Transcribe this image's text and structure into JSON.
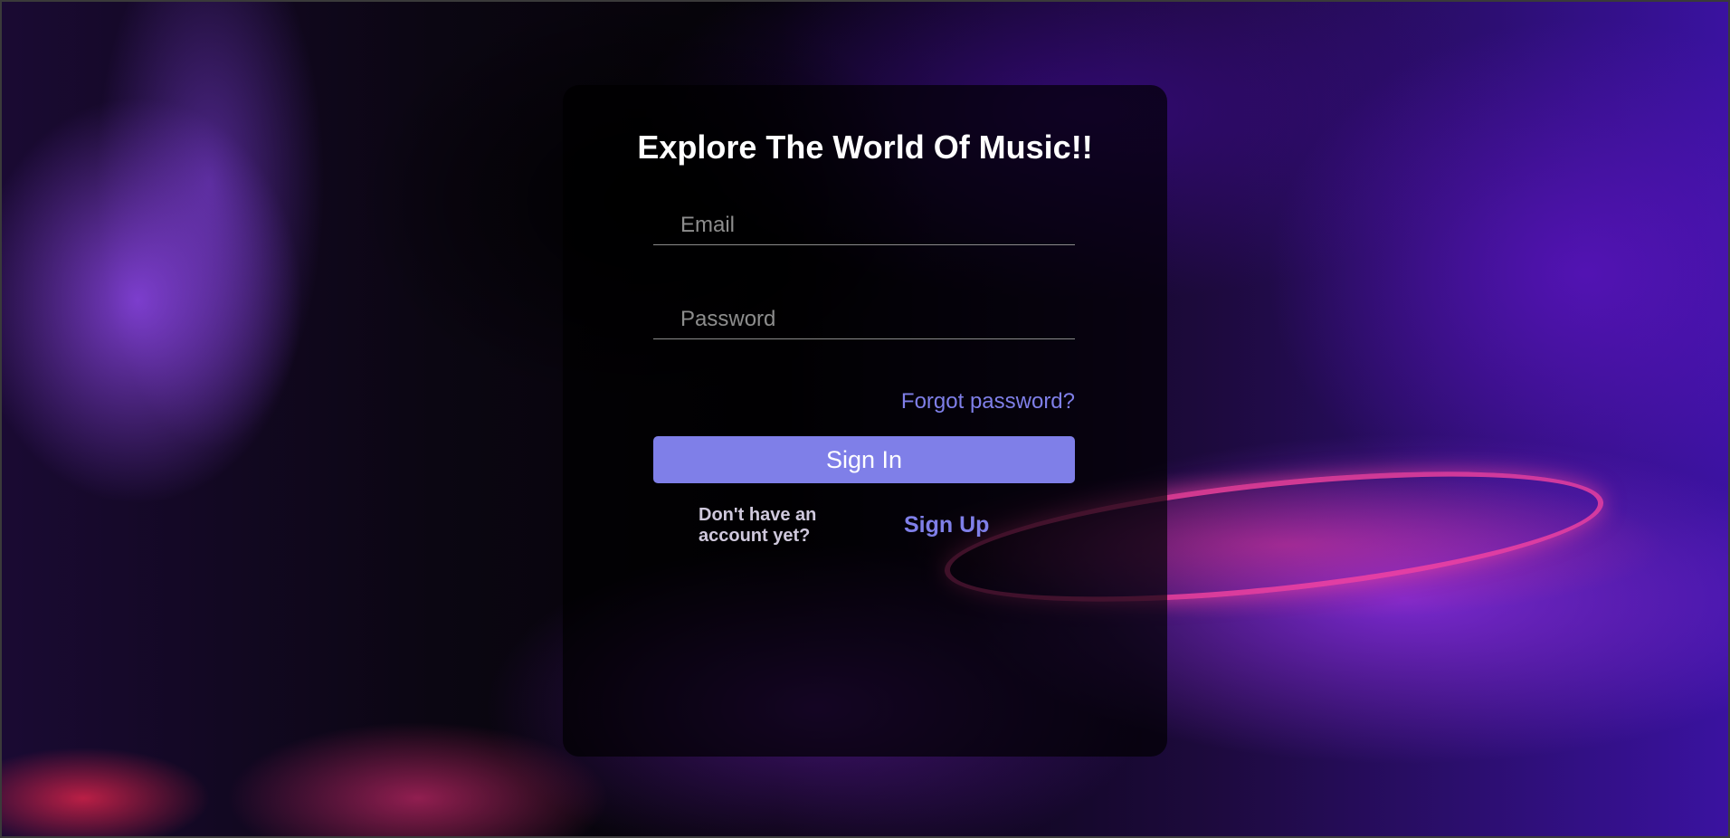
{
  "login": {
    "title": "Explore The World Of Music!!",
    "email_placeholder": "Email",
    "password_placeholder": "Password",
    "forgot_password": "Forgot password?",
    "sign_in": "Sign In",
    "no_account": "Don't have an account yet?",
    "sign_up": "Sign Up"
  },
  "colors": {
    "accent": "#7f7fe8",
    "panel": "rgba(0,0,0,0.68)",
    "title": "#ffffff"
  }
}
